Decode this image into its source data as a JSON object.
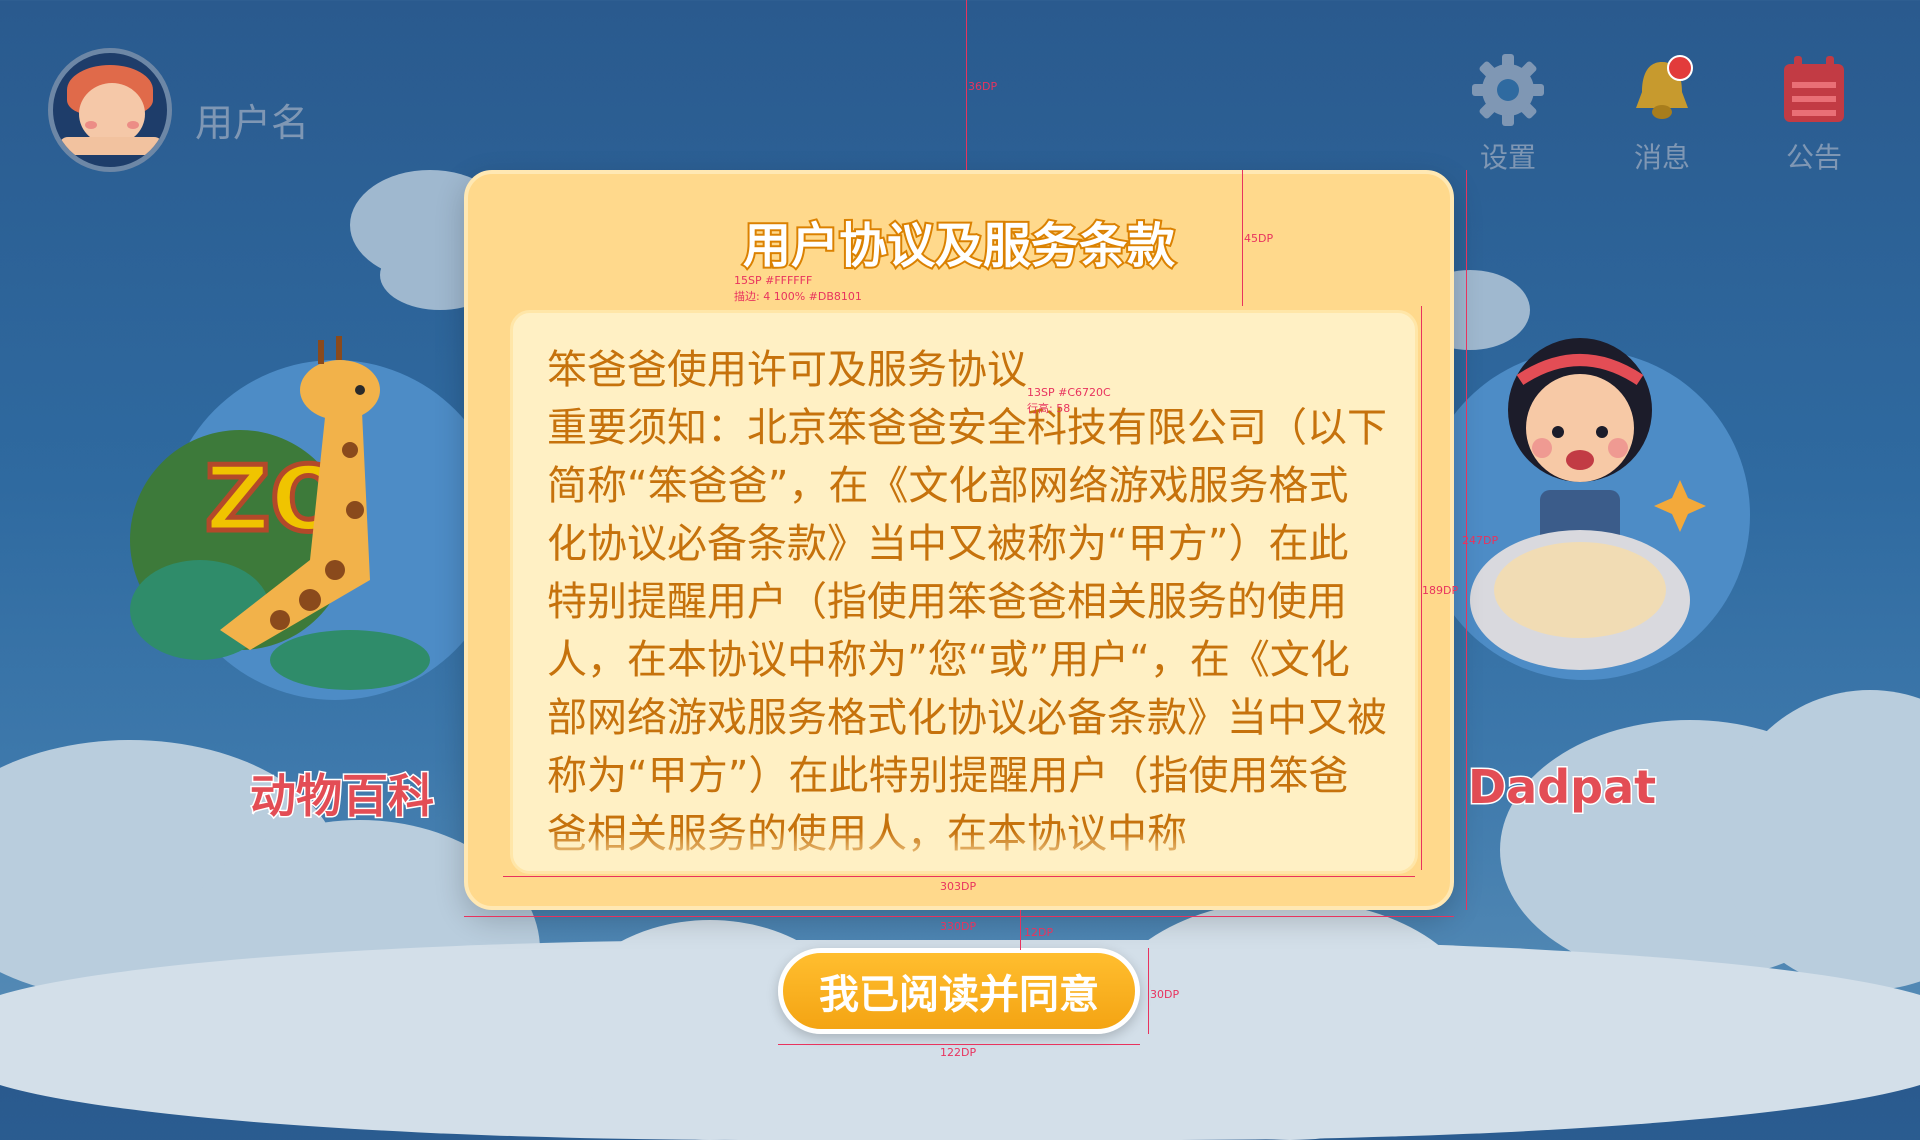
{
  "header": {
    "username": "用户名",
    "icons": [
      {
        "name": "gear-icon",
        "label": "设置"
      },
      {
        "name": "bell-icon",
        "label": "消息"
      },
      {
        "name": "calendar-icon",
        "label": "公告"
      }
    ]
  },
  "side_cards": {
    "left_caption": "动物百科",
    "right_caption": "Dadpat"
  },
  "modal": {
    "title": "用户协议及服务条款",
    "content_heading": "笨爸爸使用许可及服务协议",
    "content_body": "重要须知：北京笨爸爸安全科技有限公司（以下简称“笨爸爸”，在《文化部网络游戏服务格式化协议必备条款》当中又被称为“甲方”）在此特别提醒用户（指使用笨爸爸相关服务的使用人，在本协议中称为”您“或”用户“，在《文化部网络游戏服务格式化协议必备条款》当中又被称为“甲方”）在此特别提醒用户（指使用笨爸爸相关服务的使用人，在本协议中称为”您“或”用户“",
    "agree_button": "我已阅读并同意"
  },
  "annotations": {
    "a1": "36DP",
    "a2": "45DP",
    "a3": "15SP #FFFFFF",
    "a4": "描边: 4 100% #DB8101",
    "a5": "13SP #C6720C",
    "a6": "行高: 58",
    "a7": "247DP",
    "a8": "189DP",
    "a9": "303DP",
    "a10": "330DP",
    "a11": "12DP",
    "a12": "30DP",
    "a13": "122DP"
  },
  "colors": {
    "title_fill": "#FFFFFF",
    "title_stroke": "#DB8101",
    "content_text": "#C6720C",
    "modal_bg": "#FFD98C",
    "button": "#F4A413"
  }
}
